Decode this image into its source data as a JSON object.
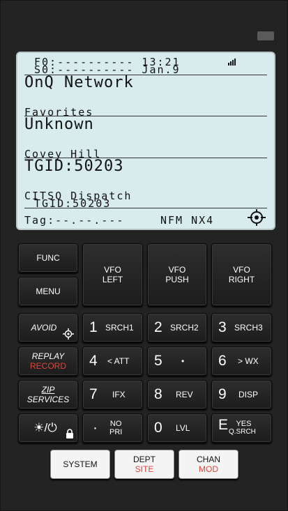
{
  "lcd": {
    "line_f": "F0:---------- 13:21",
    "line_s": "S0:---------- Jan.9",
    "system": "OnQ Network",
    "favorites": "Favorites",
    "department": "Unknown",
    "site": "Covey Hill",
    "tgid": "TGID:50203",
    "channel_name": "CITSO Dispatch",
    "channel_tgid": "TGID:50203",
    "tag": "Tag:--.--.---",
    "mode": "NFM NX4"
  },
  "keys": {
    "func": "FUNC",
    "menu": "MENU",
    "vfo_left_1": "VFO",
    "vfo_left_2": "LEFT",
    "vfo_push_1": "VFO",
    "vfo_push_2": "PUSH",
    "vfo_right_1": "VFO",
    "vfo_right_2": "RIGHT",
    "avoid": "AVOID",
    "replay": "REPLAY",
    "record": "RECORD",
    "zip": "ZIP",
    "services": "SERVICES",
    "power": "☀/⏻",
    "k1": {
      "digit": "1",
      "fn": "SRCH1"
    },
    "k2": {
      "digit": "2",
      "fn": "SRCH2"
    },
    "k3": {
      "digit": "3",
      "fn": "SRCH3"
    },
    "k4": {
      "digit": "4",
      "fn": "< ATT"
    },
    "k5": {
      "digit": "5",
      "fn": "•"
    },
    "k6": {
      "digit": "6",
      "fn": "> WX"
    },
    "k7": {
      "digit": "7",
      "fn": "IFX"
    },
    "k8": {
      "digit": "8",
      "fn": "REV"
    },
    "k9": {
      "digit": "9",
      "fn": "DISP"
    },
    "kdot": {
      "digit": "·",
      "fn1": "NO",
      "fn2": "PRI"
    },
    "k0": {
      "digit": "0",
      "fn": "LVL"
    },
    "ke": {
      "digit": "E",
      "fn1": "YES",
      "fn2": "Q.SRCH"
    },
    "system": "SYSTEM",
    "dept": "DEPT",
    "site": "SITE",
    "chan": "CHAN",
    "mod": "MOD"
  }
}
